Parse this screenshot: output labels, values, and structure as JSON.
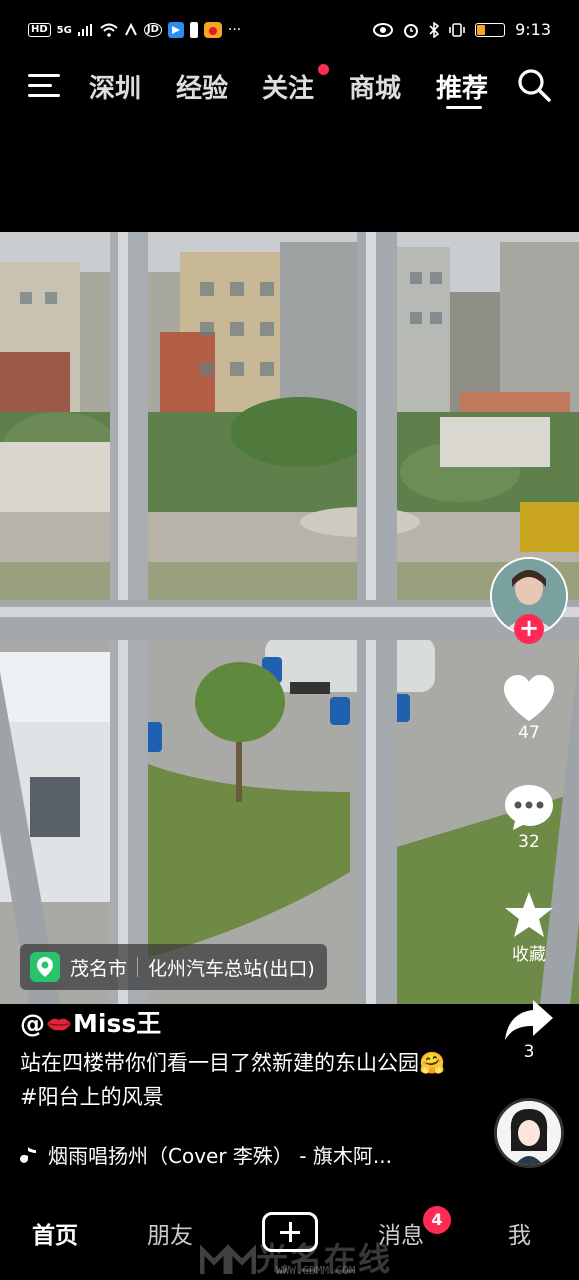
{
  "status_bar": {
    "left_icons": [
      "HD",
      "5G",
      "signal-icon",
      "wifi-icon",
      "nfc-icon",
      "JDPI",
      "app-icon",
      "battery-warning-icon",
      "weibo-icon",
      "more-icon"
    ],
    "time": "9:13",
    "battery_level": 0.3,
    "hd": "HD",
    "network": "5G",
    "jd": "JD",
    "more": "···"
  },
  "top_nav": {
    "tabs": [
      {
        "label": "深圳"
      },
      {
        "label": "经验"
      },
      {
        "label": "关注"
      },
      {
        "label": "商城"
      },
      {
        "label": "推荐"
      }
    ],
    "active_tab": "推荐",
    "notification_dot_color": "#ff2b55"
  },
  "video": {
    "location": {
      "city": "茂名市",
      "place": "化州汽车总站(出口)"
    }
  },
  "right_rail": {
    "follow_symbol": "+",
    "like_count": "47",
    "comment_count": "32",
    "favorite_label": "收藏",
    "share_count": "3"
  },
  "post": {
    "author_prefix": "@",
    "author_name": "Miss王",
    "caption": "站在四楼带你们看一目了然新建的东山公园🤗#阳台上的风景",
    "music": "烟雨唱扬州（Cover 李殊） - 旗木阿..."
  },
  "bottom_nav": {
    "items": [
      {
        "label": "首页"
      },
      {
        "label": "朋友"
      },
      {
        "label": "消息"
      },
      {
        "label": "我"
      }
    ],
    "message_badge": "4"
  },
  "watermark": {
    "text": "光名在线",
    "url": "WWW.GDMM.COM"
  },
  "colors": {
    "accent": "#ff2b55",
    "location_pin": "#27c46b"
  }
}
